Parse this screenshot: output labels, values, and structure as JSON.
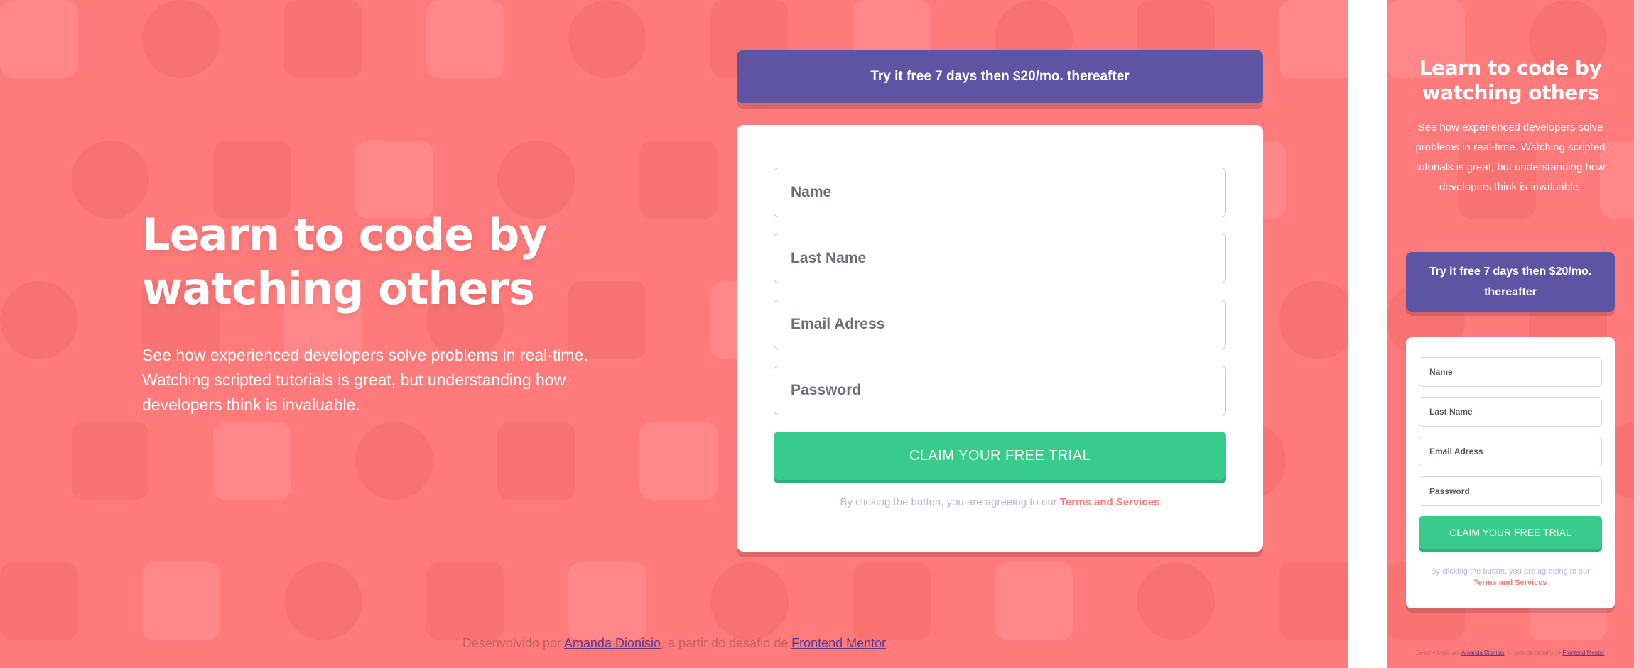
{
  "hero": {
    "title": "Learn to code by watching others",
    "description": "See how experienced developers solve problems in real-time. Watching scripted tutorials is great, but understanding how developers think is invaluable."
  },
  "banner": {
    "text": "Try it free 7 days then $20/mo. thereafter"
  },
  "form": {
    "name_placeholder": "Name",
    "last_name_placeholder": "Last Name",
    "email_placeholder": "Email Adress",
    "password_placeholder": "Password",
    "submit_label": "CLAIM YOUR FREE TRIAL",
    "terms_prefix": "By clicking the button, you are agreeing to our ",
    "terms_link": "Terms and Services"
  },
  "footer": {
    "prefix": "Desenvolvido por ",
    "author": "Amanda Dionisio",
    "middle": ", a partir do desafio de ",
    "challenge": "Frontend Mentor"
  },
  "colors": {
    "background": "#ff7a7a",
    "banner": "#5e54a4",
    "button": "#38cc8c",
    "accent": "#ff7a7a"
  }
}
